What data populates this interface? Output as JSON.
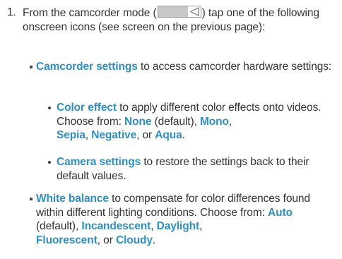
{
  "step": {
    "number": "1.",
    "part1": "From the camcorder mode (",
    "icon_name": "camcorder-mode-toggle-icon",
    "part2": ") tap one of the following onscreen icons (see screen on the previous page):"
  },
  "camcorder_settings": {
    "term": "Camcorder settings",
    "desc": " to access camcorder hardware settings:"
  },
  "color_effect": {
    "term": "Color effect",
    "desc1": " to apply different color effects onto videos. Choose from: ",
    "opt_none": "None",
    "default_note": " (default), ",
    "opt_mono": "Mono",
    "sep1": ",",
    "opt_sepia": "Sepia",
    "sep2": ", ",
    "opt_negative": "Negative",
    "sep3": ", or ",
    "opt_aqua": "Aqua",
    "end": "."
  },
  "camera_settings": {
    "term": "Camera settings",
    "desc": " to restore the settings back to their default values."
  },
  "white_balance": {
    "term": "White balance",
    "desc1": " to compensate for color differences found within different lighting conditions. Choose from: ",
    "opt_auto": "Auto",
    "default_note": " (default), ",
    "opt_incandescent": "Incandescent",
    "sep1": ", ",
    "opt_daylight": "Daylight",
    "sep2": ",",
    "opt_fluorescent": "Fluorescent",
    "sep3": ", or ",
    "opt_cloudy": "Cloudy",
    "end": "."
  },
  "colors": {
    "accent": "#2f8fc4",
    "text": "#333333"
  }
}
